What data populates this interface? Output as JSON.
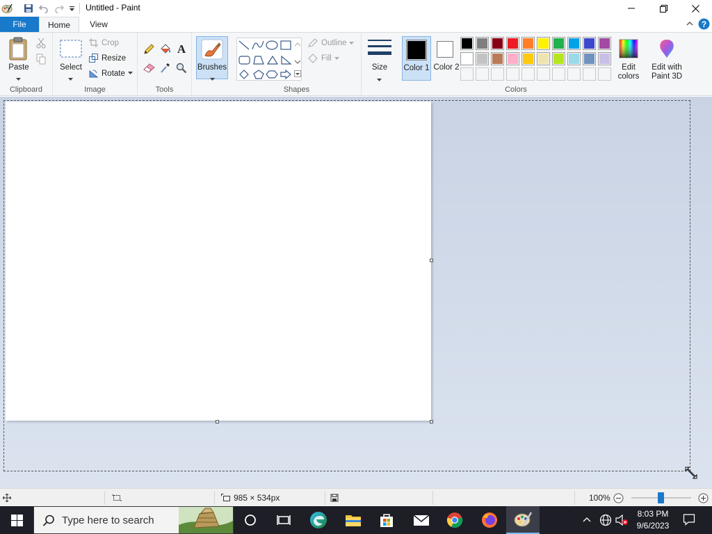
{
  "window": {
    "title": "Untitled - Paint"
  },
  "tabs": {
    "file": "File",
    "home": "Home",
    "view": "View"
  },
  "clipboard": {
    "paste": "Paste",
    "group": "Clipboard"
  },
  "image": {
    "select": "Select",
    "crop": "Crop",
    "resize": "Resize",
    "rotate": "Rotate",
    "group": "Image"
  },
  "tools": {
    "group": "Tools"
  },
  "brushes": {
    "label": "Brushes"
  },
  "shapes": {
    "outline": "Outline",
    "fill": "Fill",
    "group": "Shapes"
  },
  "size": {
    "label": "Size"
  },
  "colors": {
    "color1": "Color 1",
    "color1_num": "1",
    "color2": "Color 2",
    "color2_num": "2",
    "edit": "Edit colors",
    "paint3d": "Edit with Paint 3D",
    "group": "Colors",
    "color1_value": "#000000",
    "color2_value": "#ffffff",
    "palette_row1": [
      "#000000",
      "#7f7f7f",
      "#880015",
      "#ed1c24",
      "#ff7f27",
      "#fff200",
      "#22b14c",
      "#00a2e8",
      "#3f48cc",
      "#a349a4"
    ],
    "palette_row2": [
      "#ffffff",
      "#c3c3c3",
      "#b97a57",
      "#ffaec9",
      "#ffc90e",
      "#efe4b0",
      "#b5e61d",
      "#99d9ea",
      "#7092be",
      "#c8bfe7"
    ]
  },
  "status": {
    "dimensions": "985 × 534px",
    "zoom": "100%"
  },
  "taskbar": {
    "search_placeholder": "Type here to search",
    "time": "8:03 PM",
    "date": "9/6/2023"
  }
}
